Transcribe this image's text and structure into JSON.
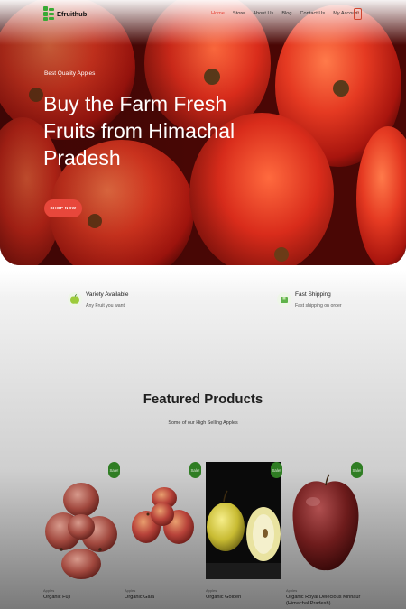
{
  "brand": {
    "name": "Efruithub"
  },
  "nav": {
    "items": [
      {
        "label": "Home",
        "active": true
      },
      {
        "label": "Store",
        "active": false
      },
      {
        "label": "About Us",
        "active": false
      },
      {
        "label": "Blog",
        "active": false
      },
      {
        "label": "Contact Us",
        "active": false
      },
      {
        "label": "My Account",
        "active": false
      }
    ],
    "cart_count": "0"
  },
  "hero": {
    "kicker": "Best Quality Apples",
    "headline": "Buy the Farm Fresh Fruits from Himachal Pradesh",
    "cta": "SHOP NOW"
  },
  "features": [
    {
      "title": "Variety Available",
      "subtitle": "Any Fruit you want",
      "icon": "apple-icon"
    },
    {
      "title": "Fast Shipping",
      "subtitle": "Fast shipping on order",
      "icon": "box-icon"
    }
  ],
  "featured": {
    "title": "Featured Products",
    "subtitle": "Some of our High Selling Apples"
  },
  "products": [
    {
      "badge": "Sale!",
      "category": "Apples",
      "name": "Organic Fuji",
      "price": ""
    },
    {
      "badge": "Sale!",
      "category": "Apples",
      "name": "Organic Gala",
      "price": ""
    },
    {
      "badge": "Sale!",
      "category": "Apples",
      "name": "Organic Golden",
      "price": ""
    },
    {
      "badge": "Sale!",
      "category": "Apples",
      "name": "Organic Royal Delecious Kinnaur (Himachal Pradesh)",
      "price": ""
    }
  ],
  "colors": {
    "accent": "#e8473b",
    "brand_green": "#39a935",
    "badge_green": "#2f7d23",
    "hero_red": "#c8271a"
  }
}
